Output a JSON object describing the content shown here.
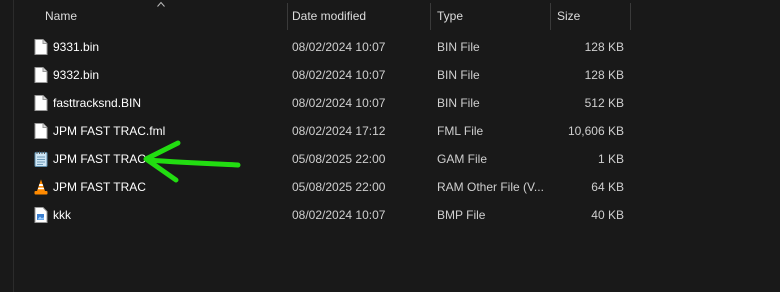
{
  "columns": {
    "name": "Name",
    "date_modified": "Date modified",
    "type": "Type",
    "size": "Size"
  },
  "files": [
    {
      "name": "9331.bin",
      "date": "08/02/2024 10:07",
      "type": "BIN File",
      "size": "128 KB",
      "icon": "document-icon"
    },
    {
      "name": "9332.bin",
      "date": "08/02/2024 10:07",
      "type": "BIN File",
      "size": "128 KB",
      "icon": "document-icon"
    },
    {
      "name": "fasttracksnd.BIN",
      "date": "08/02/2024 10:07",
      "type": "BIN File",
      "size": "512 KB",
      "icon": "document-icon"
    },
    {
      "name": "JPM FAST TRAC.fml",
      "date": "08/02/2024 17:12",
      "type": "FML File",
      "size": "10,606 KB",
      "icon": "document-icon"
    },
    {
      "name": "JPM FAST TRAC",
      "date": "05/08/2025 22:00",
      "type": "GAM File",
      "size": "1 KB",
      "icon": "notepad-icon"
    },
    {
      "name": "JPM FAST TRAC",
      "date": "05/08/2025 22:00",
      "type": "RAM Other File (V...",
      "size": "64 KB",
      "icon": "vlc-cone-icon"
    },
    {
      "name": "kkk",
      "date": "08/02/2024 10:07",
      "type": "BMP File",
      "size": "40 KB",
      "icon": "bitmap-icon"
    }
  ],
  "colors": {
    "background": "#191919",
    "annotation_arrow": "#22dd11"
  }
}
